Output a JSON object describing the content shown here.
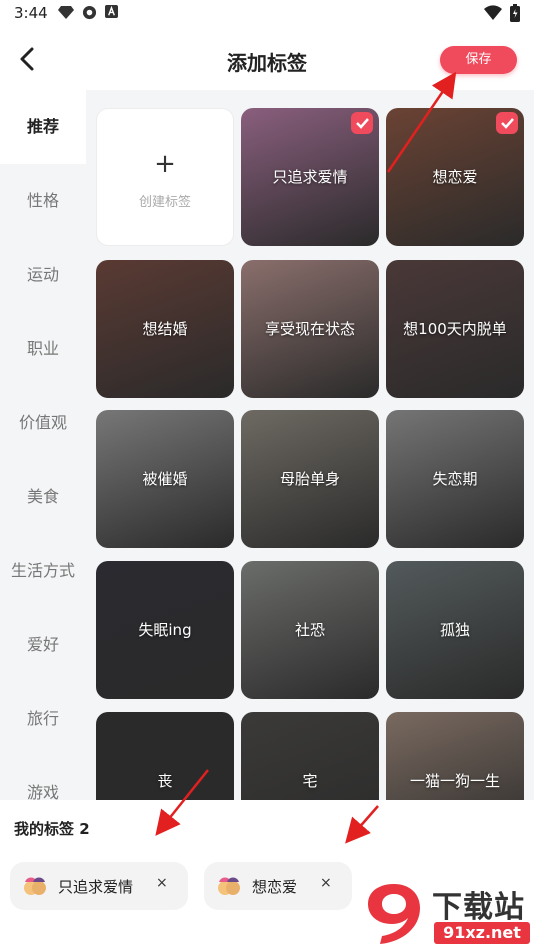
{
  "status_bar": {
    "time": "3:44",
    "left_icons": [
      "diamond-icon",
      "aperture-icon",
      "a-square-icon"
    ],
    "right_icons": [
      "wifi-icon",
      "battery-icon"
    ]
  },
  "header": {
    "title": "添加标签",
    "save_label": "保存",
    "back_icon": "chevron-left-icon"
  },
  "sidebar": {
    "categories": [
      {
        "label": "推荐",
        "active": true
      },
      {
        "label": "性格",
        "active": false
      },
      {
        "label": "运动",
        "active": false
      },
      {
        "label": "职业",
        "active": false
      },
      {
        "label": "价值观",
        "active": false
      },
      {
        "label": "美食",
        "active": false
      },
      {
        "label": "生活方式",
        "active": false
      },
      {
        "label": "爱好",
        "active": false
      },
      {
        "label": "旅行",
        "active": false
      },
      {
        "label": "游戏",
        "active": false
      }
    ]
  },
  "grid": {
    "create_card": {
      "plus": "+",
      "label": "创建标签"
    },
    "cards": [
      {
        "label": "只追求爱情",
        "checked": true,
        "color": "#8a5f7e"
      },
      {
        "label": "想恋爱",
        "checked": true,
        "color": "#6b4334"
      },
      {
        "label": "想结婚",
        "checked": false,
        "color": "#5a3a33"
      },
      {
        "label": "享受现在状态",
        "checked": false,
        "color": "#8a6f6c"
      },
      {
        "label": "想100天内脱单",
        "checked": false,
        "color": "#4a3838"
      },
      {
        "label": "被催婚",
        "checked": false,
        "color": "#777777"
      },
      {
        "label": "母胎单身",
        "checked": false,
        "color": "#6e6a63"
      },
      {
        "label": "失恋期",
        "checked": false,
        "color": "#757575"
      },
      {
        "label": "失眠ing",
        "checked": false,
        "color": "#2b2a30"
      },
      {
        "label": "社恐",
        "checked": false,
        "color": "#6b6d6a"
      },
      {
        "label": "孤独",
        "checked": false,
        "color": "#535a5b"
      },
      {
        "label": "丧",
        "checked": false,
        "color": "#2a2a2a"
      },
      {
        "label": "宅",
        "checked": false,
        "color": "#3b3a38"
      },
      {
        "label": "一猫一狗一生",
        "checked": false,
        "color": "#7a6a60"
      }
    ]
  },
  "my_tags": {
    "title": "我的标签 2",
    "chips": [
      {
        "label": "只追求爱情",
        "close": "×"
      },
      {
        "label": "想恋爱",
        "close": "×"
      }
    ]
  },
  "watermark": {
    "text": "下载站",
    "url": "91xz.net",
    "logo": "9"
  },
  "colors": {
    "accent": "#f04a5d",
    "sidebar_bg": "#f4f5f7"
  }
}
